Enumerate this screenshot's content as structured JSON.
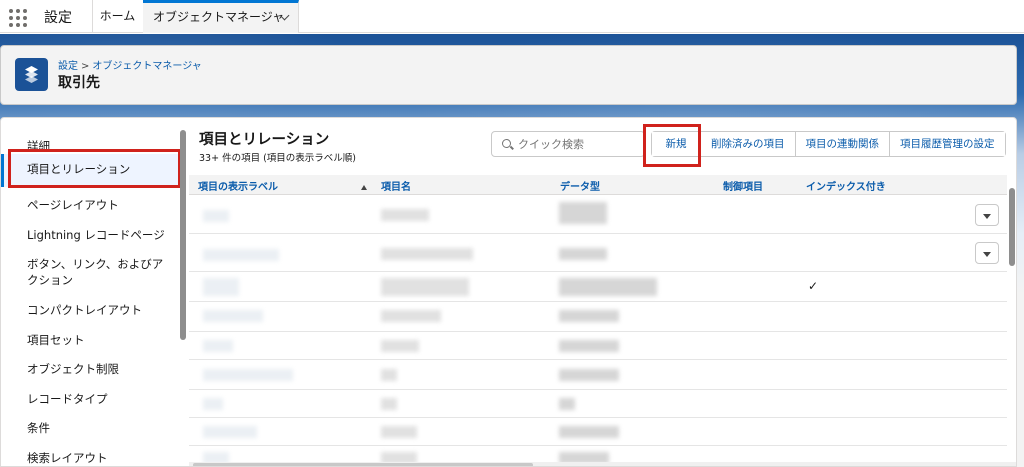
{
  "topnav": {
    "app_name": "設定",
    "tabs": [
      {
        "label": "ホーム"
      },
      {
        "label": "オブジェクトマネージャ"
      }
    ]
  },
  "header": {
    "breadcrumb": [
      "設定",
      "オブジェクトマネージャ"
    ],
    "breadcrumb_sep": ">",
    "title": "取引先",
    "icon": "stack-layers-icon"
  },
  "sidebar": {
    "items": [
      {
        "label": "詳細"
      },
      {
        "label": "項目とリレーション",
        "active": true
      },
      {
        "label": "ページレイアウト"
      },
      {
        "label": "Lightning レコードページ"
      },
      {
        "label": "ボタン、リンク、およびア"
      },
      {
        "label": "クション"
      },
      {
        "label": "コンパクトレイアウト"
      },
      {
        "label": "項目セット"
      },
      {
        "label": "オブジェクト制限"
      },
      {
        "label": "レコードタイプ"
      },
      {
        "label": "条件"
      },
      {
        "label": "検索レイアウト"
      }
    ]
  },
  "content": {
    "title": "項目とリレーション",
    "subtitle": "33+ 件の項目 (項目の表示ラベル順)",
    "search_placeholder": "クイック検索",
    "buttons": [
      {
        "label": "新規"
      },
      {
        "label": "削除済みの項目"
      },
      {
        "label": "項目の連動関係"
      },
      {
        "label": "項目履歴管理の設定"
      }
    ],
    "columns": [
      "項目の表示ラベル",
      "項目名",
      "データ型",
      "制御項目",
      "インデックス付き"
    ],
    "sort_column": "項目の表示ラベル",
    "check_mark": "✓"
  },
  "colors": {
    "brand_blue": "#1b5297",
    "link_blue": "#0b5cab",
    "active_border": "#0176d3",
    "highlight_red": "#d0221c"
  }
}
